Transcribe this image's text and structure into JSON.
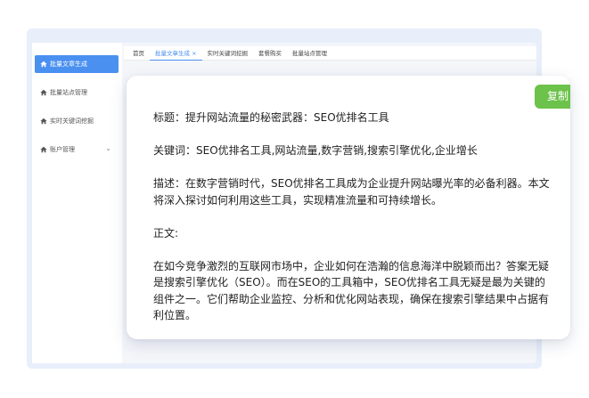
{
  "sidebar": {
    "items": [
      {
        "label": "批量文章生成",
        "icon": "home-icon",
        "active": true
      },
      {
        "label": "批量站点管理",
        "icon": "home-icon",
        "active": false
      },
      {
        "label": "实时关键词挖掘",
        "icon": "home-icon",
        "active": false
      },
      {
        "label": "账户管理",
        "icon": "home-icon",
        "active": false,
        "expandable": true
      }
    ]
  },
  "tabs": [
    {
      "label": "首页"
    },
    {
      "label": "批量文章生成 ×",
      "active": true
    },
    {
      "label": "实时关键词挖掘"
    },
    {
      "label": "套餐购买"
    },
    {
      "label": "批量站点管理"
    }
  ],
  "result": {
    "copy_label": "复制",
    "title_line": "标题：提升网站流量的秘密武器：SEO优排名工具",
    "keywords_line": "关键词：SEO优排名工具,网站流量,数字营销,搜索引擎优化,企业增长",
    "description_line": "描述：在数字营销时代，SEO优排名工具成为企业提升网站曝光率的必备利器。本文将深入探讨如何利用这些工具，实现精准流量和可持续增长。",
    "body_heading": "正文:",
    "body_paragraph": "在如今竞争激烈的互联网市场中，企业如何在浩瀚的信息海洋中脱颖而出？答案无疑是搜索引擎优化（SEO）。而在SEO的工具箱中，SEO优排名工具无疑是最为关键的组件之一。它们帮助企业监控、分析和优化网站表现，确保在搜索引擎结果中占据有利位置。"
  },
  "colors": {
    "accent": "#4a90f0",
    "copy_button": "#6cc24a"
  }
}
